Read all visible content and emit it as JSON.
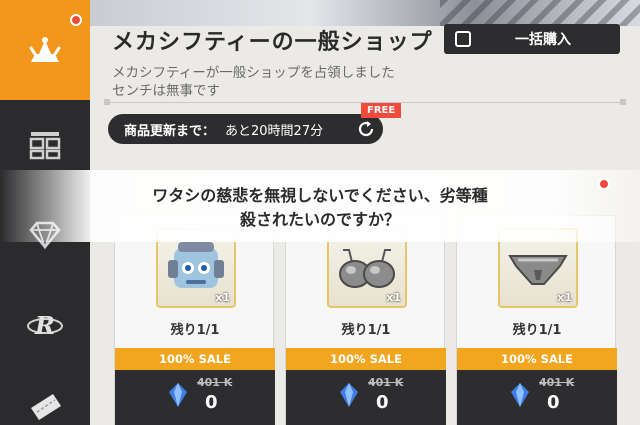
{
  "shop": {
    "title": "メカシフティーの一般ショップ",
    "description_line1": "メカシフティーが一般ショップを占領しました",
    "description_line2": "センチは無事です",
    "bulk_buy_label": "一括購入",
    "refresh_label": "商品更新まで：",
    "refresh_time": "あと20時間27分",
    "free_tag": "FREE"
  },
  "dialog": {
    "line1": "ワタシの慈悲を無視しないでください、劣等種",
    "line2": "殺されたいのですか？"
  },
  "items": [
    {
      "image": "mecha-head-figure",
      "qty": "x1",
      "remain": "残り1/1",
      "sale": "100% SALE",
      "old_price": "401 K",
      "price": "0"
    },
    {
      "image": "metal-bra",
      "qty": "x1",
      "remain": "残り1/1",
      "sale": "100% SALE",
      "old_price": "401 K",
      "price": "0"
    },
    {
      "image": "metal-briefs",
      "qty": "x1",
      "remain": "残り1/1",
      "sale": "100% SALE",
      "old_price": "401 K",
      "price": "0"
    }
  ],
  "sidebar": {
    "tabs": [
      {
        "icon": "shop-bird-icon",
        "active": true
      },
      {
        "icon": "grid-shop-icon",
        "active": false
      },
      {
        "icon": "diamond-icon",
        "active": false
      },
      {
        "icon": "r-logo-icon",
        "active": false
      },
      {
        "icon": "ticket-icon",
        "active": false
      }
    ]
  },
  "colors": {
    "accent": "#f2961c",
    "dark": "#2d2d2f",
    "sale": "#f2a51f",
    "alert": "#f04a3a"
  }
}
